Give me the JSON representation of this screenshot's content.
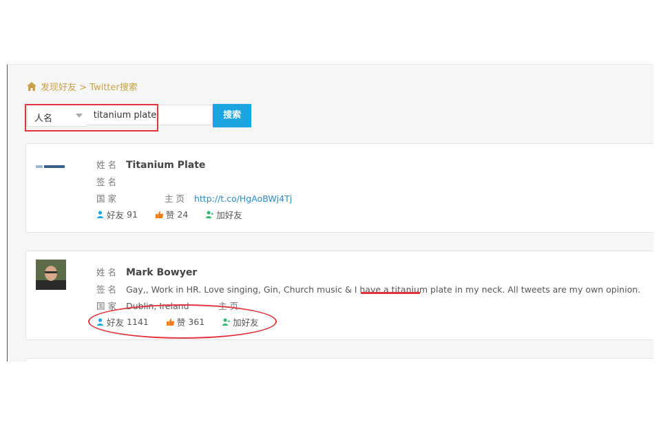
{
  "breadcrumb": {
    "text": "发现好友 > Twitter搜索"
  },
  "search": {
    "type_selected": "人名",
    "query": "titanium plate",
    "button_label": "搜索"
  },
  "labels": {
    "name": "姓名",
    "bio": "签名",
    "country": "国家",
    "homepage": "主页",
    "friends": "好友",
    "likes": "赞",
    "add_friend": "加好友"
  },
  "results": [
    {
      "name": "Titanium Plate",
      "bio": "",
      "country": "",
      "homepage": "http://t.co/HgAoBWj4Tj",
      "friends": "91",
      "likes": "24"
    },
    {
      "name": "Mark Bowyer",
      "bio": "Gay,, Work in HR. Love singing, Gin, Church music & I have a titanium plate in my neck. All tweets are my own opinion.",
      "country": "Dublin, Ireland",
      "homepage": "",
      "friends": "1141",
      "likes": "361"
    }
  ],
  "colors": {
    "accent": "#1aa5e0",
    "highlight": "#e0333b",
    "breadcrumb": "#c9a14a"
  }
}
